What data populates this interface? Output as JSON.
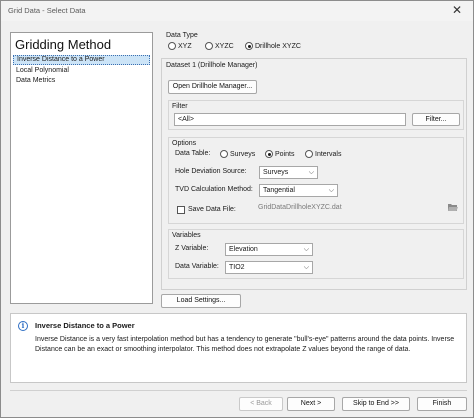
{
  "window": {
    "title": "Grid Data - Select Data",
    "close_glyph": "✕"
  },
  "methods": {
    "heading": "Gridding Method",
    "items": [
      "Inverse Distance to a Power",
      "Local Polynomial",
      "Data Metrics"
    ],
    "selected_index": 0
  },
  "data_type": {
    "label": "Data Type",
    "options": [
      "XYZ",
      "XYZC",
      "Drillhole XYZC"
    ],
    "selected": "Drillhole XYZC"
  },
  "dataset": {
    "label": "Dataset 1 (Drillhole Manager)",
    "open_button": "Open Drillhole Manager..."
  },
  "filter": {
    "label": "Filter",
    "value": "<All>",
    "button": "Filter..."
  },
  "options": {
    "label": "Options",
    "data_table_label": "Data Table:",
    "data_table_options": [
      "Surveys",
      "Points",
      "Intervals"
    ],
    "data_table_selected": "Points",
    "hole_deviation_label": "Hole Deviation Source:",
    "hole_deviation_value": "Surveys",
    "tvd_label": "TVD Calculation Method:",
    "tvd_value": "Tangential",
    "save_data_label": "Save Data File:",
    "save_data_checked": false,
    "save_data_value": "GridDataDrillholeXYZC.dat",
    "folder_icon": "folder-open-icon"
  },
  "variables": {
    "label": "Variables",
    "z_label": "Z Variable:",
    "z_value": "Elevation",
    "data_label": "Data Variable:",
    "data_value": "TIO2"
  },
  "load_settings_button": "Load Settings...",
  "info": {
    "icon_glyph": "i",
    "title": "Inverse Distance to a Power",
    "text": "Inverse Distance is a very fast interpolation method but has a tendency to generate \"bull's-eye\" patterns around the data points. Inverse Distance can be an exact or smoothing interpolator. This method does not extrapolate Z values beyond the range of data."
  },
  "footer": {
    "back": "< Back",
    "next": "Next >",
    "skip": "Skip to End >>",
    "finish": "Finish"
  },
  "colors": {
    "selection_bg": "#cce4f7",
    "window_bg": "#f0f0f0",
    "info_icon": "#2f6fc4"
  }
}
